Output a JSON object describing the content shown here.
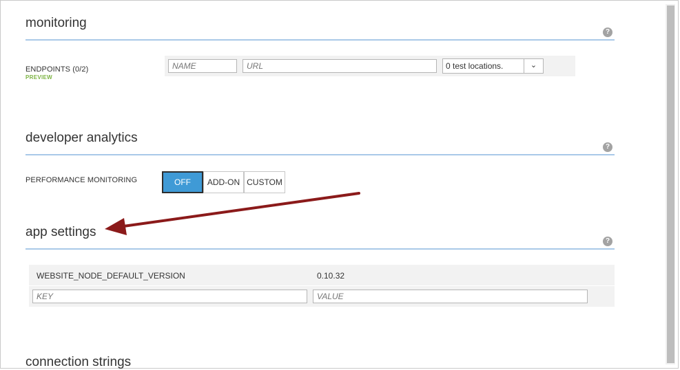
{
  "monitoring": {
    "title": "monitoring",
    "endpoints_label": "ENDPOINTS (0/2)",
    "preview_badge": "PREVIEW",
    "name_placeholder": "NAME",
    "url_placeholder": "URL",
    "locations_value": "0 test locations.",
    "help_glyph": "?"
  },
  "developer_analytics": {
    "title": "developer analytics",
    "perf_label": "PERFORMANCE MONITORING",
    "options": [
      "OFF",
      "ADD-ON",
      "CUSTOM"
    ],
    "selected": "OFF",
    "help_glyph": "?"
  },
  "app_settings": {
    "title": "app settings",
    "rows": [
      {
        "key": "WEBSITE_NODE_DEFAULT_VERSION",
        "value": "0.10.32"
      }
    ],
    "key_placeholder": "KEY",
    "value_placeholder": "VALUE",
    "help_glyph": "?"
  },
  "connection_strings": {
    "title": "connection strings"
  },
  "colors": {
    "accent": "#3f9ad6",
    "rule": "#a9c9e8",
    "preview": "#7cb342",
    "arrow": "#8b1a1a"
  },
  "icons": {
    "help": "help-icon",
    "dropdown": "chevron-down-icon",
    "annotation": "arrow-annotation-icon"
  }
}
